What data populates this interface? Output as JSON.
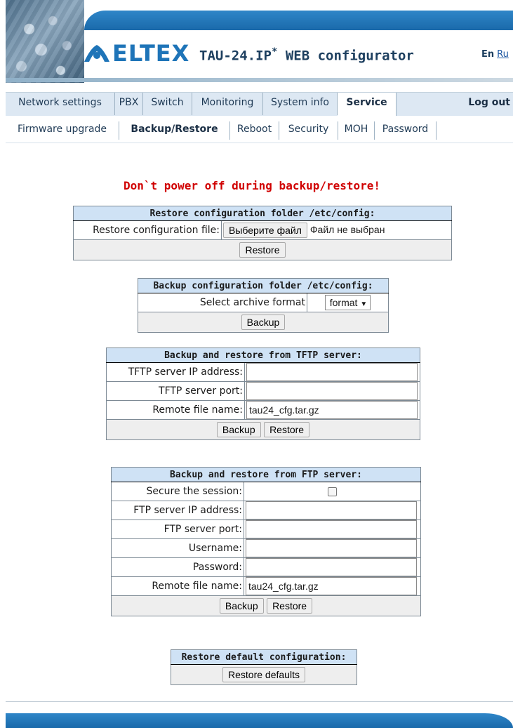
{
  "header": {
    "logo_text": "ELTEX",
    "title": "TAU-24.IP",
    "title_mark": "*",
    "title_suffix": "WEB configurator",
    "lang_en": "En",
    "lang_ru": "Ru"
  },
  "main_menu": {
    "items": [
      "Network settings",
      "PBX",
      "Switch",
      "Monitoring",
      "System info",
      "Service"
    ],
    "active": "Service",
    "logout": "Log out"
  },
  "sub_menu": {
    "items": [
      "Firmware upgrade",
      "Backup/Restore",
      "Reboot",
      "Security",
      "MOH",
      "Password"
    ],
    "active": "Backup/Restore"
  },
  "warning": "Don`t power off during backup/restore!",
  "restore_config": {
    "header": "Restore configuration folder /etc/config:",
    "file_label": "Restore configuration file:",
    "file_button": "Выберите файл",
    "file_status": "Файл не выбран",
    "restore_button": "Restore"
  },
  "backup_config": {
    "header": "Backup configuration folder /etc/config:",
    "format_label": "Select archive format",
    "format_value": "format",
    "backup_button": "Backup"
  },
  "tftp": {
    "header": "Backup and restore from TFTP server:",
    "ip_label": "TFTP server IP address:",
    "ip_value": "",
    "port_label": "TFTP server port:",
    "port_value": "",
    "file_label": "Remote file name:",
    "file_value": "tau24_cfg.tar.gz",
    "backup_button": "Backup",
    "restore_button": "Restore"
  },
  "ftp": {
    "header": "Backup and restore from FTP server:",
    "secure_label": "Secure the session:",
    "secure_checked": false,
    "ip_label": "FTP server IP address:",
    "ip_value": "",
    "port_label": "FTP server port:",
    "port_value": "",
    "user_label": "Username:",
    "user_value": "",
    "pass_label": "Password:",
    "pass_value": "",
    "file_label": "Remote file name:",
    "file_value": "tau24_cfg.tar.gz",
    "backup_button": "Backup",
    "restore_button": "Restore"
  },
  "defaults": {
    "header": "Restore default configuration:",
    "button": "Restore defaults"
  },
  "colors": {
    "accent_blue": "#1e74b8",
    "warning_red": "#d00000",
    "table_header_bg": "#cfe2f5",
    "menu_bg": "#dde8f3"
  }
}
